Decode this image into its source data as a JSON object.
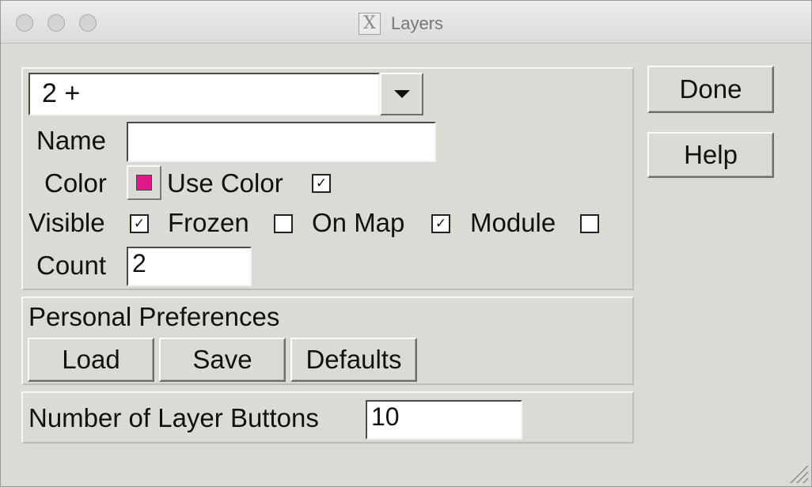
{
  "window": {
    "title": "Layers",
    "title_icon": "X"
  },
  "layer_select": {
    "value": "2 +"
  },
  "name": {
    "label": "Name",
    "value": ""
  },
  "color": {
    "label": "Color",
    "swatch_color": "#e0198b",
    "use_color_label": "Use Color",
    "use_color_checked": true
  },
  "flags": [
    {
      "label": "Visible",
      "checked": true
    },
    {
      "label": "Frozen",
      "checked": false
    },
    {
      "label": "On Map",
      "checked": true
    },
    {
      "label": "Module",
      "checked": false
    }
  ],
  "count": {
    "label": "Count",
    "value": "2"
  },
  "prefs": {
    "title": "Personal Preferences",
    "load": "Load",
    "save": "Save",
    "defaults": "Defaults"
  },
  "layer_buttons": {
    "label": "Number of Layer Buttons",
    "value": "10"
  },
  "actions": {
    "done": "Done",
    "help": "Help"
  },
  "check_mark": "✓"
}
